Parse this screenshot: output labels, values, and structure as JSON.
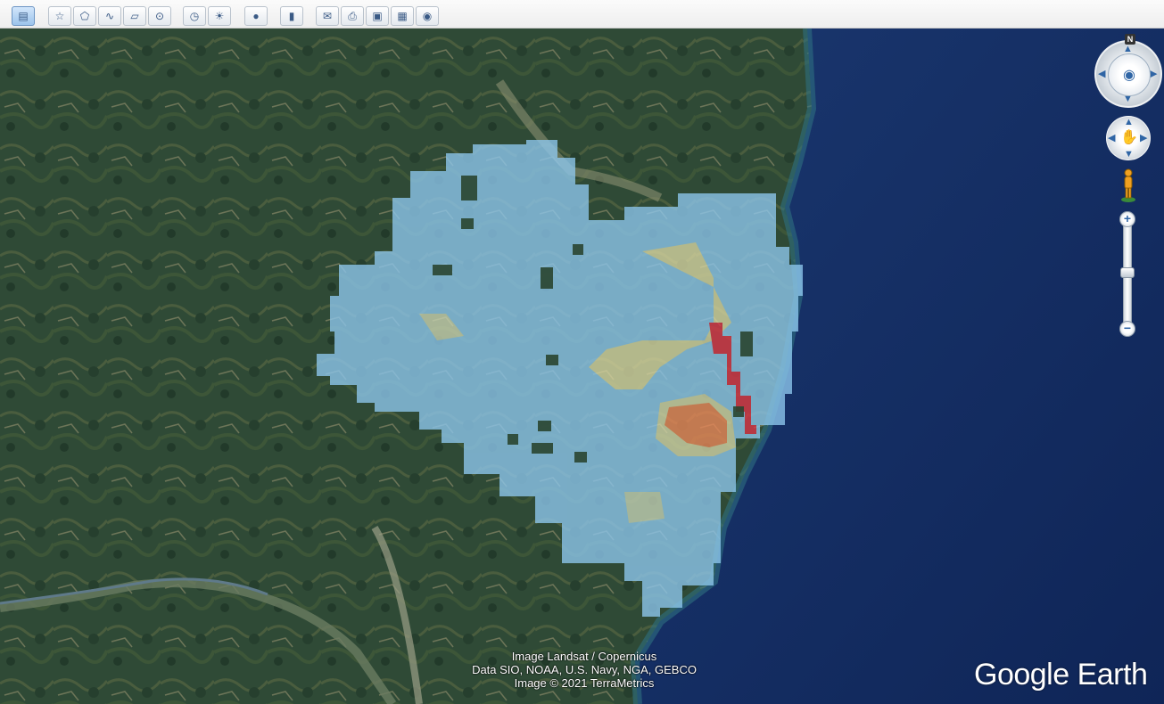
{
  "toolbar": {
    "buttons": [
      {
        "id": "sidebar",
        "icon": "sidebar-toggle-icon",
        "active": true
      },
      {
        "id": "placemark",
        "icon": "add-placemark-icon"
      },
      {
        "id": "polygon",
        "icon": "add-polygon-icon"
      },
      {
        "id": "path",
        "icon": "add-path-icon"
      },
      {
        "id": "overlay",
        "icon": "add-image-overlay-icon"
      },
      {
        "id": "tour",
        "icon": "record-tour-icon"
      },
      {
        "id": "history",
        "icon": "historical-imagery-icon"
      },
      {
        "id": "sunlight",
        "icon": "sunlight-icon"
      },
      {
        "id": "planets",
        "icon": "planets-icon"
      },
      {
        "id": "ruler",
        "icon": "ruler-icon"
      },
      {
        "id": "email",
        "icon": "email-icon"
      },
      {
        "id": "print",
        "icon": "print-icon"
      },
      {
        "id": "save-image",
        "icon": "save-image-icon"
      },
      {
        "id": "view-in-maps",
        "icon": "view-in-maps-icon"
      },
      {
        "id": "earth",
        "icon": "earth-icon"
      }
    ]
  },
  "map": {
    "colors": {
      "land": "#2f4a36",
      "ocean": "#16306a",
      "overlay_low": "#8ec8ee",
      "overlay_mid": "#f2dc8a",
      "overlay_high": "#ee8050",
      "overlay_max": "#dd3548"
    }
  },
  "navigation": {
    "north_label": "N",
    "zoom_in_label": "+",
    "zoom_out_label": "−"
  },
  "attribution": {
    "line1": "Image Landsat / Copernicus",
    "line2": "Data SIO, NOAA, U.S. Navy, NGA, GEBCO",
    "line3": "Image © 2021 TerraMetrics"
  },
  "brand": "Google Earth"
}
